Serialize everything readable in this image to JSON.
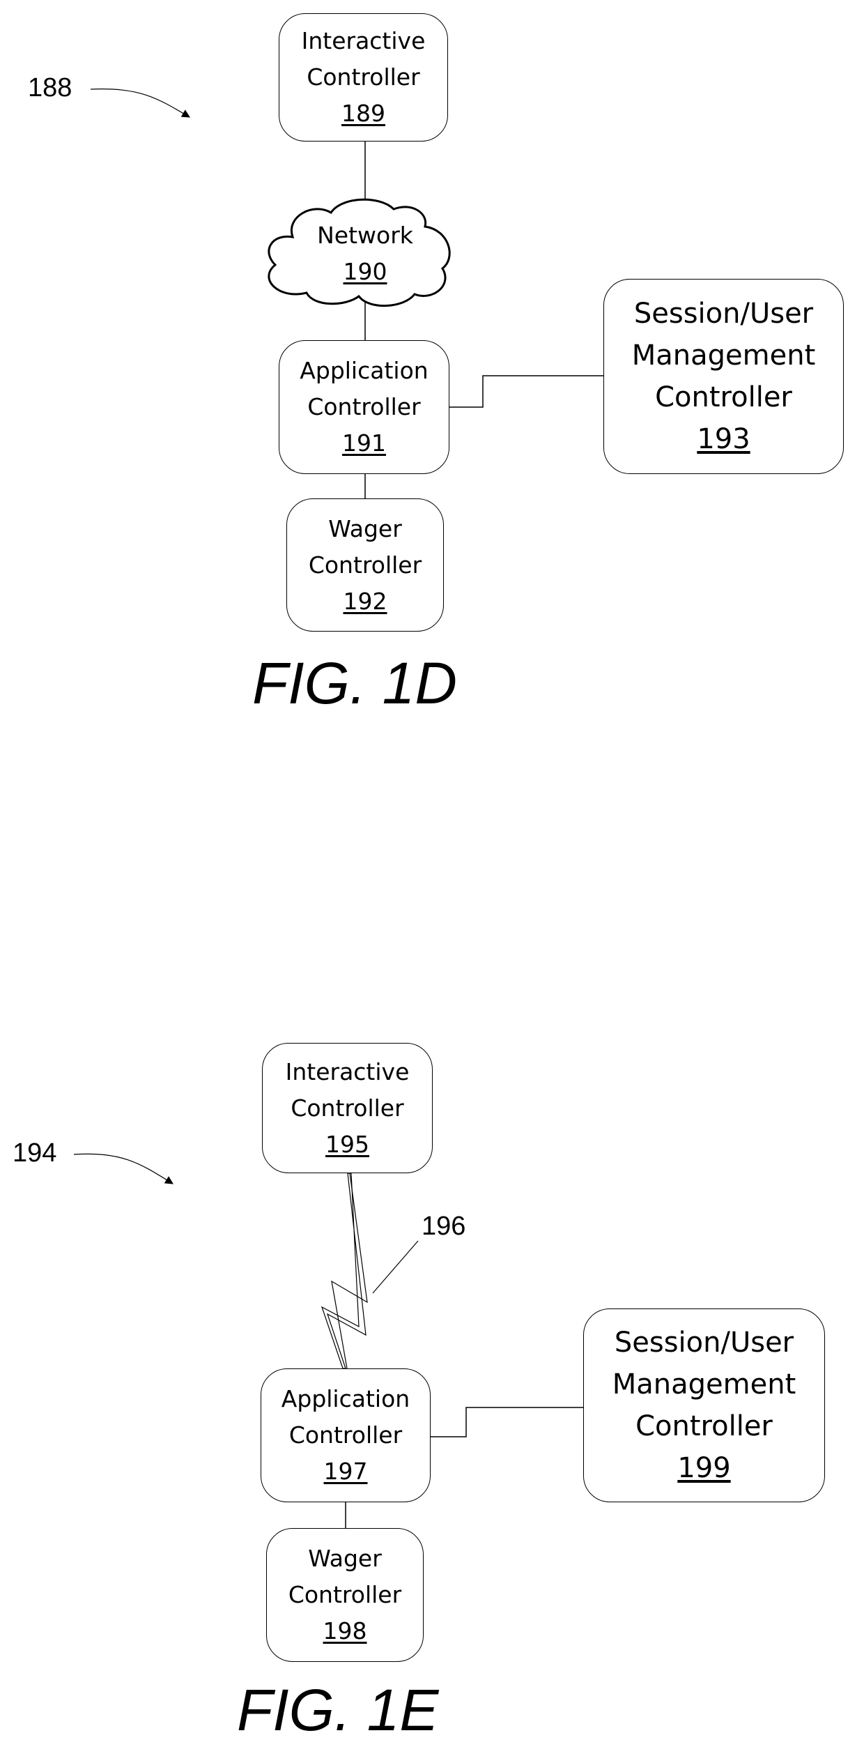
{
  "fig1d": {
    "ref": "188",
    "title": "FIG. 1D",
    "interactive": {
      "line1": "Interactive",
      "line2": "Controller",
      "ref": "189"
    },
    "network": {
      "line1": "Network",
      "ref": "190"
    },
    "application": {
      "line1": "Application",
      "line2": "Controller",
      "ref": "191"
    },
    "wager": {
      "line1": "Wager",
      "line2": "Controller",
      "ref": "192"
    },
    "session": {
      "line1": "Session/User",
      "line2": "Management",
      "line3": "Controller",
      "ref": "193"
    }
  },
  "fig1e": {
    "ref": "194",
    "title": "FIG. 1E",
    "interactive": {
      "line1": "Interactive",
      "line2": "Controller",
      "ref": "195"
    },
    "wireless_ref": "196",
    "application": {
      "line1": "Application",
      "line2": "Controller",
      "ref": "197"
    },
    "wager": {
      "line1": "Wager",
      "line2": "Controller",
      "ref": "198"
    },
    "session": {
      "line1": "Session/User",
      "line2": "Management",
      "line3": "Controller",
      "ref": "199"
    }
  }
}
